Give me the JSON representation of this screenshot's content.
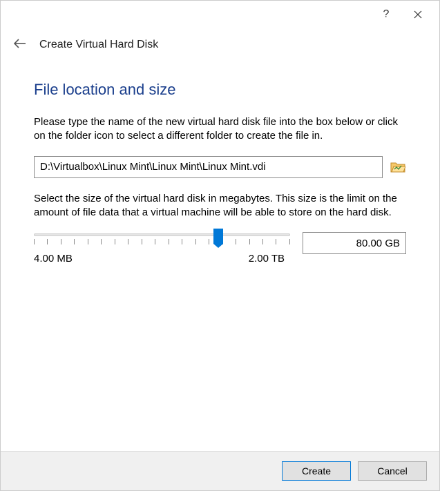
{
  "titlebar": {
    "help_label": "?",
    "close_label": "✕"
  },
  "header": {
    "title": "Create Virtual Hard Disk"
  },
  "section": {
    "heading": "File location and size",
    "location_help": "Please type the name of the new virtual hard disk file into the box below or click on the folder icon to select a different folder to create the file in.",
    "file_path": "D:\\Virtualbox\\Linux Mint\\Linux Mint\\Linux Mint.vdi",
    "size_help": "Select the size of the virtual hard disk in megabytes. This size is the limit on the amount of file data that a virtual machine will be able to store on the hard disk.",
    "slider_min_label": "4.00 MB",
    "slider_max_label": "2.00 TB",
    "size_value": "80.00 GB"
  },
  "footer": {
    "create_label": "Create",
    "cancel_label": "Cancel"
  }
}
